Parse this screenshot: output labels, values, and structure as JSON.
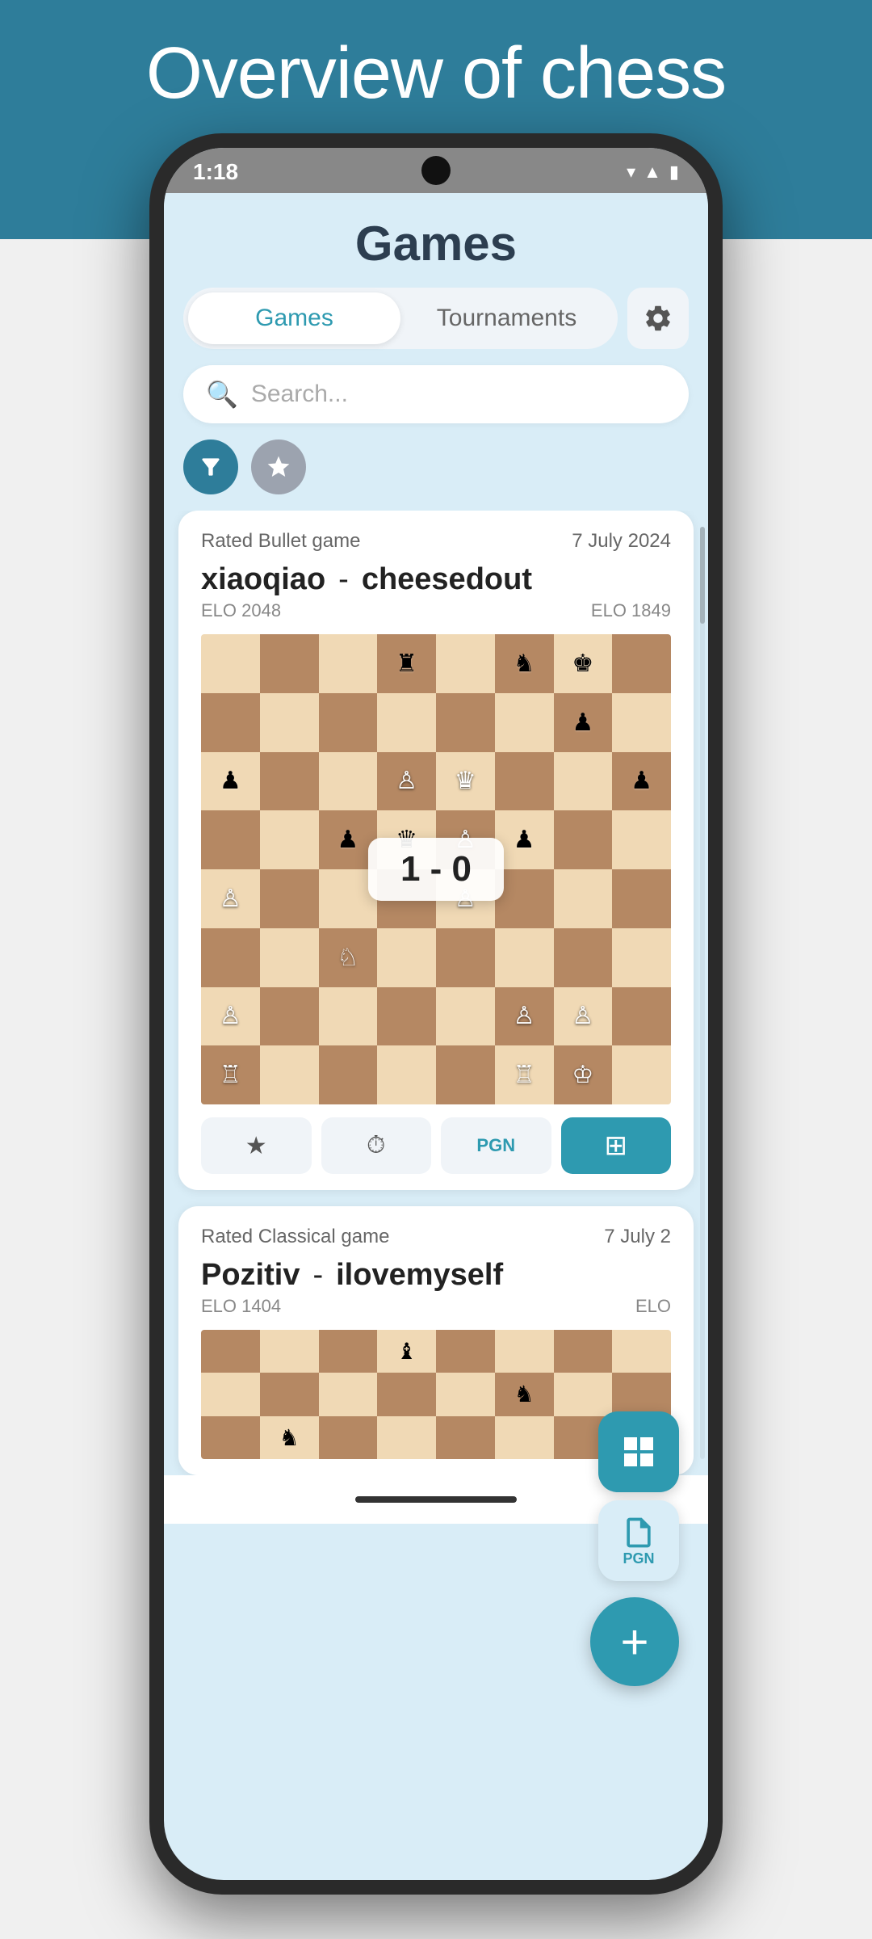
{
  "header": {
    "title": "Overview of chess games",
    "background": "#2e7d9a"
  },
  "status_bar": {
    "time": "1:18",
    "wifi": "▼",
    "signal": "▲",
    "battery": "🔋"
  },
  "app": {
    "title": "Games",
    "tabs": [
      {
        "label": "Games",
        "active": true
      },
      {
        "label": "Tournaments",
        "active": false
      }
    ],
    "settings_label": "settings",
    "search_placeholder": "Search...",
    "filter_label": "filter",
    "favorites_label": "favorites"
  },
  "game1": {
    "type": "Rated Bullet game",
    "date": "7 July 2024",
    "player1": "xiaoqiao",
    "player1_elo": "ELO 2048",
    "dash": "-",
    "player2": "cheesedout",
    "player2_elo": "ELO 1849",
    "result": "1 - 0",
    "actions": {
      "star": "★",
      "clock": "⏱",
      "pgn": "PGN",
      "analysis": "⊞"
    }
  },
  "game2": {
    "type": "Rated Classical game",
    "date": "7 July 2",
    "player1": "Pozitiv",
    "player1_elo": "ELO 1404",
    "dash": "-",
    "player2": "ilovemyself",
    "player2_elo": "ELO"
  },
  "board1": {
    "pieces": [
      {
        "row": 0,
        "col": 3,
        "piece": "♜",
        "color": "black"
      },
      {
        "row": 0,
        "col": 5,
        "piece": "♞",
        "color": "black"
      },
      {
        "row": 0,
        "col": 6,
        "piece": "♚",
        "color": "black"
      },
      {
        "row": 1,
        "col": 6,
        "piece": "♟",
        "color": "black"
      },
      {
        "row": 2,
        "col": 0,
        "piece": "♟",
        "color": "black"
      },
      {
        "row": 2,
        "col": 3,
        "piece": "♙",
        "color": "white"
      },
      {
        "row": 2,
        "col": 4,
        "piece": "♛",
        "color": "white"
      },
      {
        "row": 2,
        "col": 7,
        "piece": "♟",
        "color": "black"
      },
      {
        "row": 3,
        "col": 2,
        "piece": "♟",
        "color": "black"
      },
      {
        "row": 3,
        "col": 3,
        "piece": "♛",
        "color": "black"
      },
      {
        "row": 3,
        "col": 4,
        "piece": "♙",
        "color": "white"
      },
      {
        "row": 3,
        "col": 5,
        "piece": "♟",
        "color": "black"
      },
      {
        "row": 4,
        "col": 0,
        "piece": "♙",
        "color": "white"
      },
      {
        "row": 4,
        "col": 4,
        "piece": "♙",
        "color": "white"
      },
      {
        "row": 5,
        "col": 2,
        "piece": "♘",
        "color": "white"
      },
      {
        "row": 6,
        "col": 0,
        "piece": "♙",
        "color": "white"
      },
      {
        "row": 6,
        "col": 5,
        "piece": "♙",
        "color": "white"
      },
      {
        "row": 6,
        "col": 6,
        "piece": "♙",
        "color": "white"
      },
      {
        "row": 7,
        "col": 0,
        "piece": "♖",
        "color": "white"
      },
      {
        "row": 7,
        "col": 5,
        "piece": "♖",
        "color": "white"
      },
      {
        "row": 7,
        "col": 6,
        "piece": "♔",
        "color": "white"
      }
    ]
  },
  "fab": {
    "pgn_label": "PGN",
    "add_label": "+"
  }
}
